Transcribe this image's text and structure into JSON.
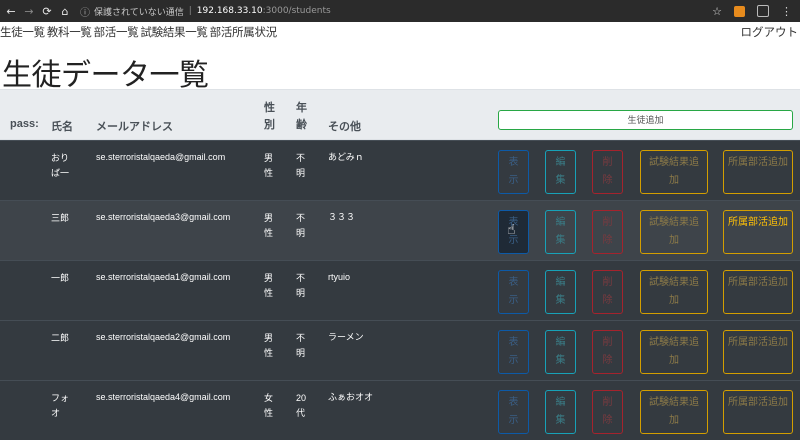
{
  "browser": {
    "security_label": "保護されていない通信",
    "host": "192.168.33.10",
    "path": ":3000/students"
  },
  "nav": {
    "links": [
      "生徒一覧",
      "教科一覧",
      "部活一覧",
      "試験結果一覧",
      "部活所属状況"
    ],
    "logout": "ログアウト"
  },
  "page_title": "生徒データ一覧",
  "table": {
    "headers": {
      "pass": "pass:",
      "name": "氏名",
      "email": "メールアドレス",
      "gender": "性別",
      "age": "年齢",
      "other": "その他"
    },
    "add_button": "生徒追加",
    "button_labels": {
      "show": "表示",
      "edit": "編集",
      "delete": "削除",
      "add_exam": "試験結果追加",
      "add_club": "所属部活追加"
    },
    "rows": [
      {
        "name": "おりば一",
        "email": "se.sterroristalqaeda@gmail.com",
        "gender": "男性",
        "age": "不明",
        "other": "あどみｎ"
      },
      {
        "name": "三郎",
        "email": "se.sterroristalqaeda3@gmail.com",
        "gender": "男性",
        "age": "不明",
        "other": "３３３"
      },
      {
        "name": "一郎",
        "email": "se.sterroristalqaeda1@gmail.com",
        "gender": "男性",
        "age": "不明",
        "other": "rtyuio"
      },
      {
        "name": "二郎",
        "email": "se.sterroristalqaeda2@gmail.com",
        "gender": "男性",
        "age": "不明",
        "other": "ラーメン"
      },
      {
        "name": "フォオ",
        "email": "se.sterroristalqaeda4@gmail.com",
        "gender": "女性",
        "age": "20代",
        "other": "ふぁおオオ"
      }
    ]
  }
}
